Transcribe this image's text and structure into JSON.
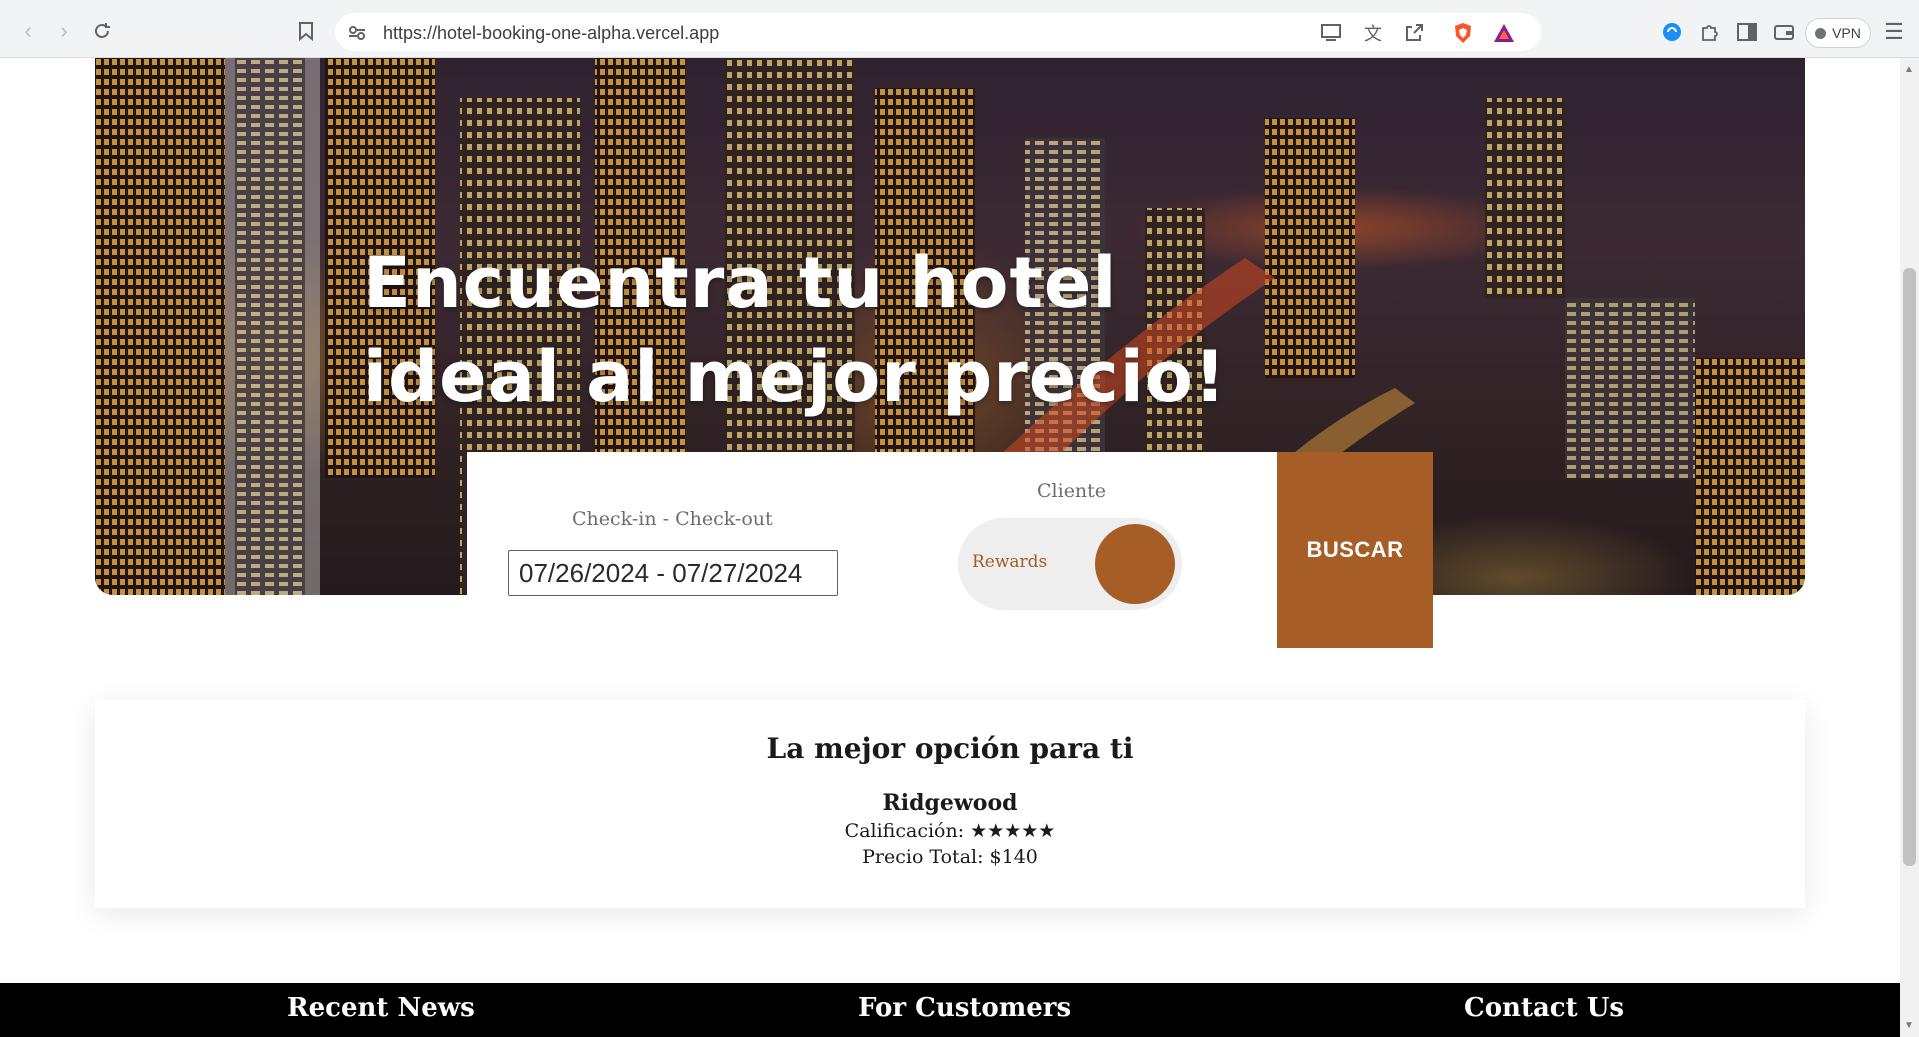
{
  "browser": {
    "url": "https://hotel-booking-one-alpha.vercel.app",
    "vpn_label": "VPN",
    "icons": [
      "back-icon",
      "forward-icon",
      "reload-icon",
      "bookmark-icon",
      "site-info-icon",
      "install-icon",
      "translate-icon",
      "share-icon",
      "brave-shields-icon",
      "brave-rewards-icon",
      "extension-icon",
      "puzzle-icon",
      "sidebar-icon",
      "wallet-icon",
      "menu-icon"
    ]
  },
  "hero": {
    "title_line1": "Encuentra tu hotel",
    "title_line2": "ideal al mejor precio!"
  },
  "search": {
    "date_label": "Check-in - Check-out",
    "date_value": "07/26/2024 - 07/27/2024",
    "client_label": "Cliente",
    "toggle_label": "Rewards",
    "button_label": "BUSCAR"
  },
  "result": {
    "title": "La mejor opción para ti",
    "hotel_name": "Ridgewood",
    "rating_label": "Calificación:",
    "rating_stars": "★★★★★",
    "rating_value": 5,
    "price_text": "Precio Total: $140"
  },
  "footer": {
    "headings": [
      "Recent News",
      "For Customers",
      "Contact Us"
    ]
  },
  "colors": {
    "accent": "#a65d26",
    "footer_bg": "#000000"
  }
}
